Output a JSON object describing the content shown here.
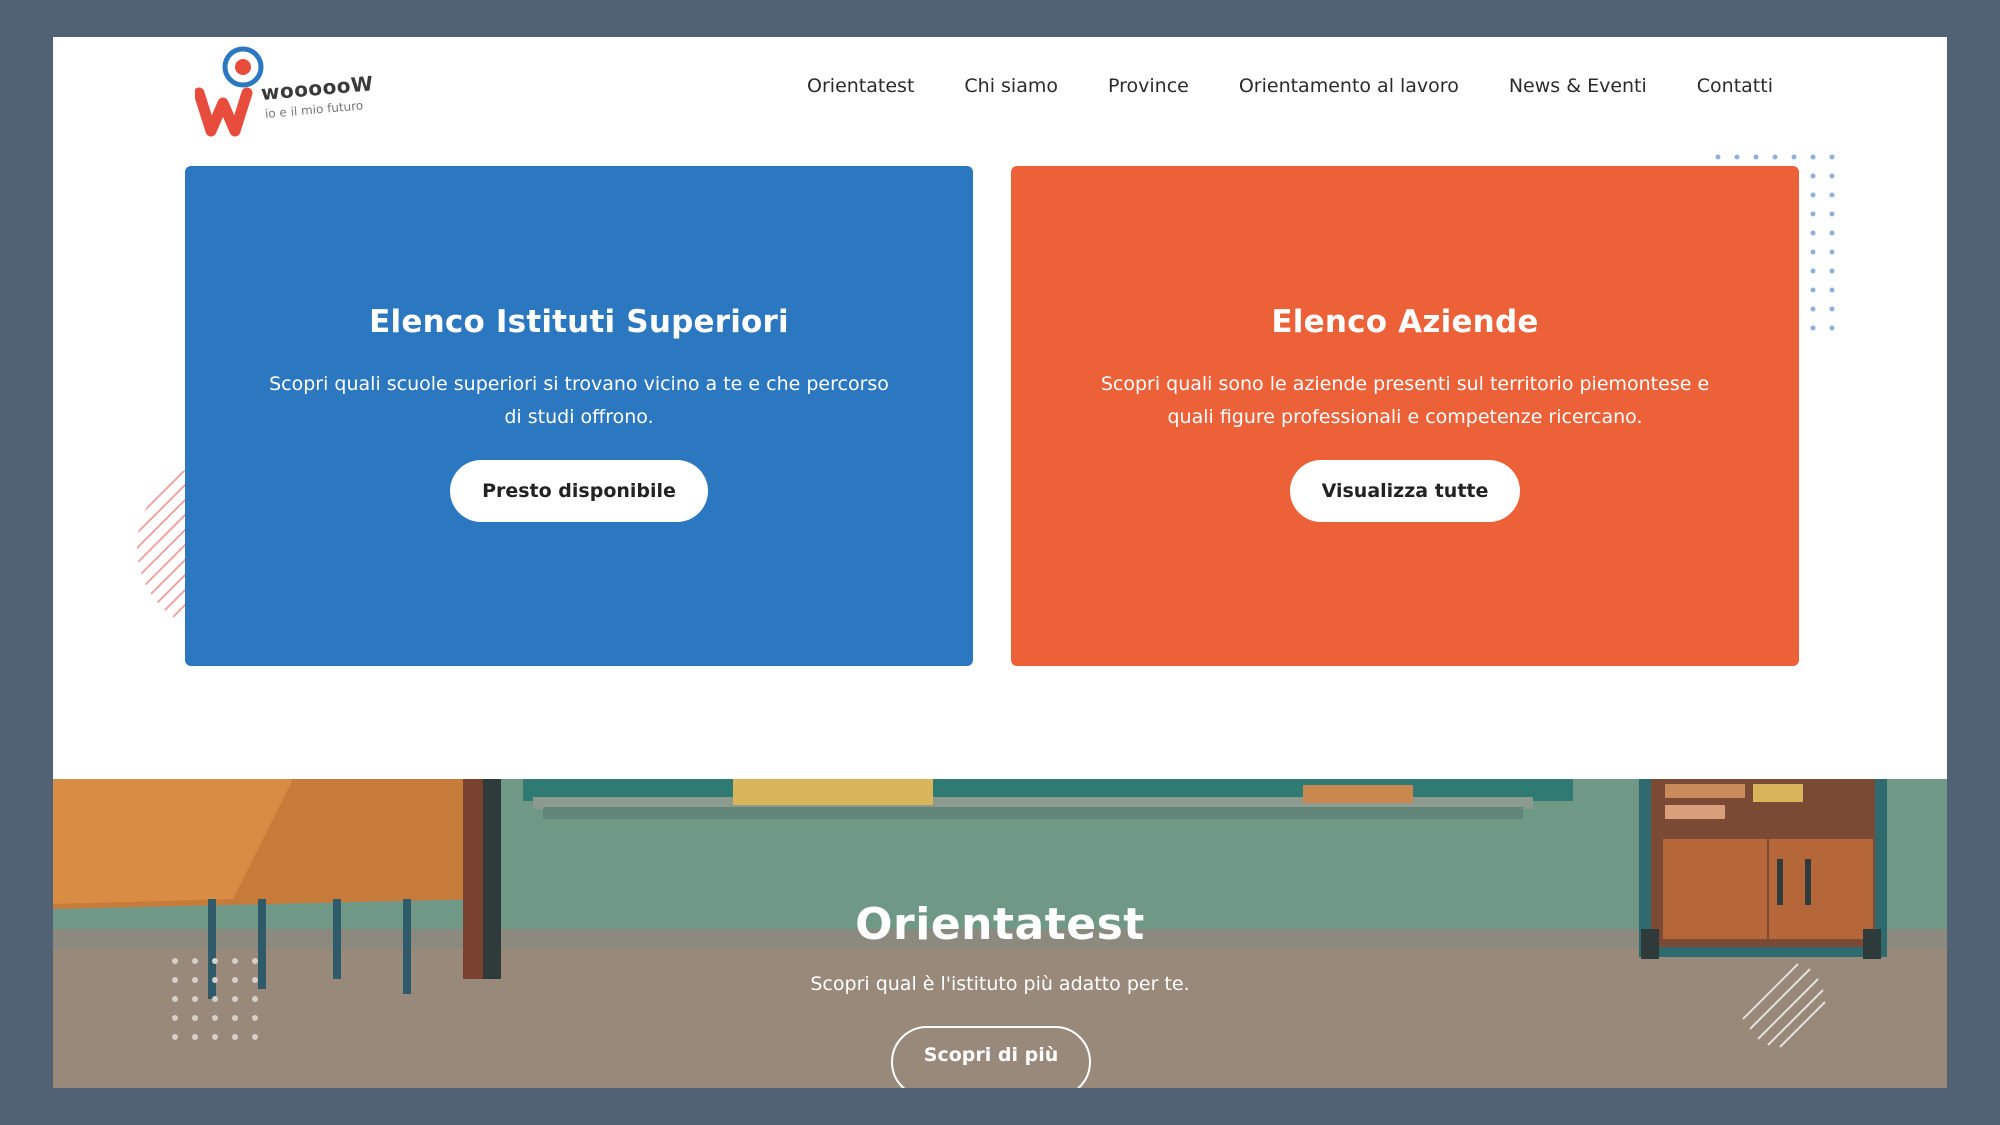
{
  "logo": {
    "word": "woooooW",
    "tagline": "io e il mio futuro",
    "alt": "wooooow logo"
  },
  "nav": {
    "items": [
      {
        "label": "Orientatest"
      },
      {
        "label": "Chi siamo"
      },
      {
        "label": "Province"
      },
      {
        "label": "Orientamento al lavoro"
      },
      {
        "label": "News & Eventi"
      },
      {
        "label": "Contatti"
      }
    ]
  },
  "cards": [
    {
      "title": "Elenco Istituti Superiori",
      "text": "Scopri quali scuole superiori si trovano vicino a te e che percorso di studi offrono.",
      "button": "Presto disponibile",
      "color": "#2b77c0"
    },
    {
      "title": "Elenco Aziende",
      "text": "Scopri quali sono le aziende presenti sul territorio piemontese e quali figure professionali e competenze ricercano.",
      "button": "Visualizza tutte",
      "color": "#ec6138"
    }
  ],
  "hero": {
    "title": "Orientatest",
    "subtitle": "Scopri qual è l'istituto più adatto per te.",
    "button": "Scopri di più"
  },
  "colors": {
    "background": "#526275",
    "accent_blue": "#2b77c0",
    "accent_orange": "#ec6138"
  }
}
